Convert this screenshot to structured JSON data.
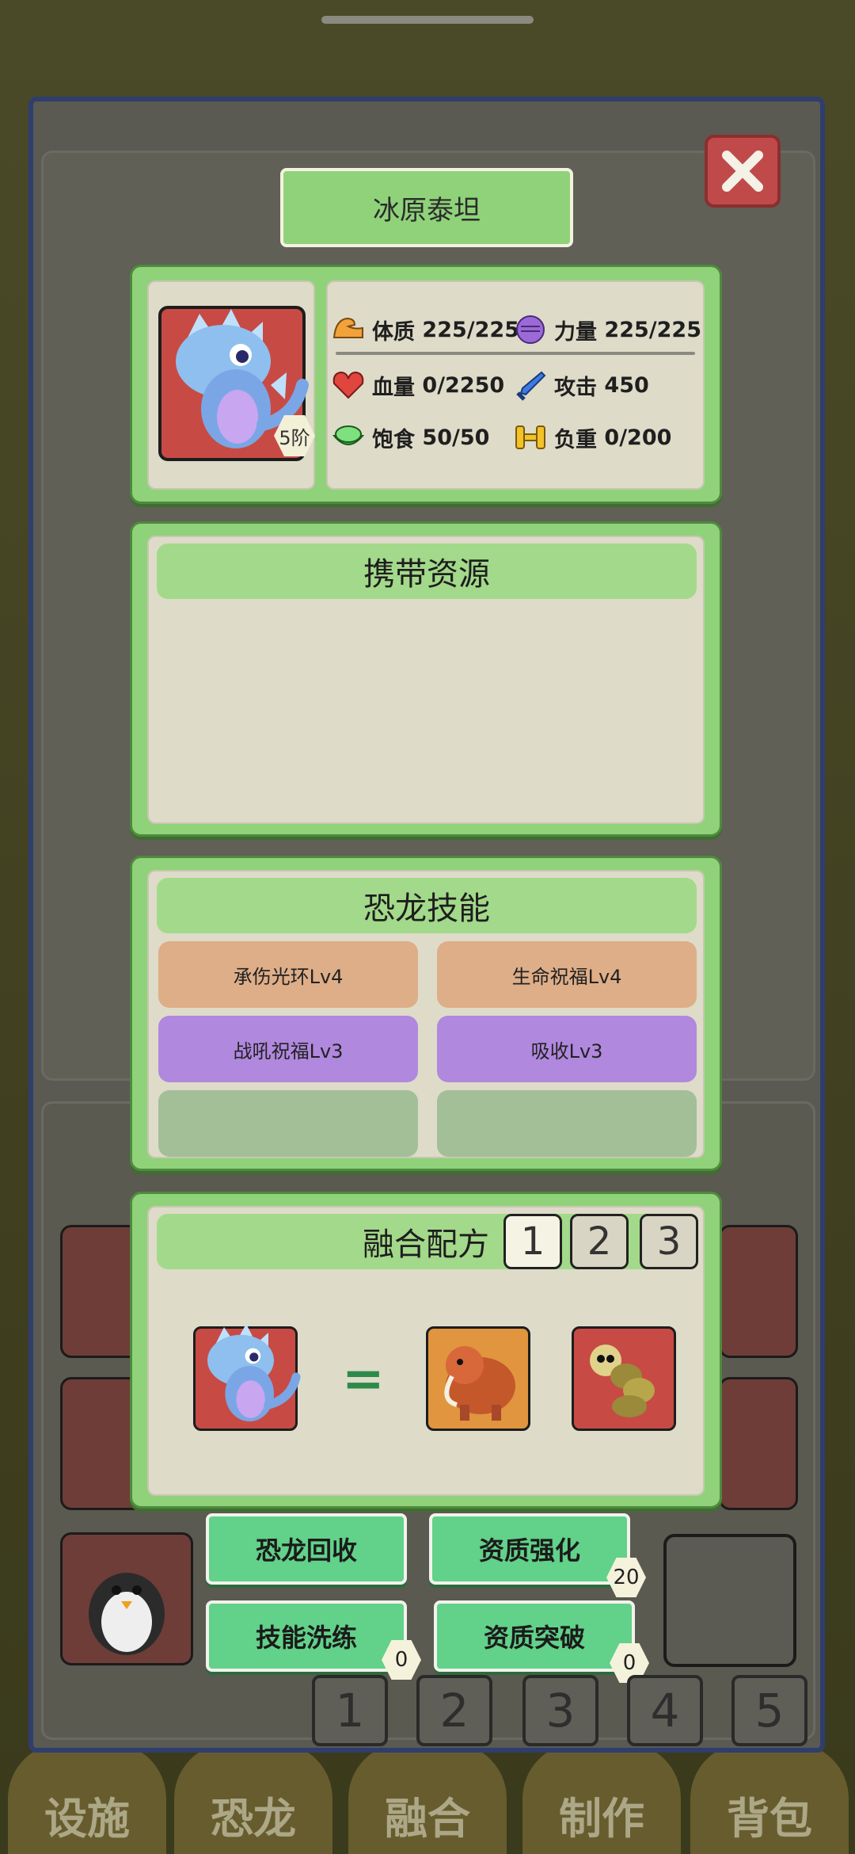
{
  "dino": {
    "name": "冰原泰坦",
    "tier": "5阶",
    "stats": {
      "constitution": {
        "label": "体质",
        "value": "225/225",
        "icon": "muscle-arm-icon",
        "color": "#f2a23a"
      },
      "strength": {
        "label": "力量",
        "value": "225/225",
        "icon": "fist-icon",
        "color": "#9b6ad6"
      },
      "hp": {
        "label": "血量",
        "value": "0/2250",
        "icon": "heart-icon",
        "color": "#e0463e"
      },
      "attack": {
        "label": "攻击",
        "value": "450",
        "icon": "sword-icon",
        "color": "#3d7be0"
      },
      "satiety": {
        "label": "饱食",
        "value": "50/50",
        "icon": "food-bowl-icon",
        "color": "#3fbf3f"
      },
      "load": {
        "label": "负重",
        "value": "0/200",
        "icon": "dumbbell-icon",
        "color": "#f2c22a"
      }
    }
  },
  "resources": {
    "title": "携带资源"
  },
  "skills": {
    "title": "恐龙技能",
    "items": [
      {
        "label": "承伤光环Lv4",
        "color": "#deae88"
      },
      {
        "label": "生命祝福Lv4",
        "color": "#deae88"
      },
      {
        "label": "战吼祝福Lv3",
        "color": "#b088de"
      },
      {
        "label": "吸收Lv3",
        "color": "#b088de"
      },
      {
        "label": "",
        "color": "#a3bf98"
      },
      {
        "label": "",
        "color": "#a3bf98"
      }
    ]
  },
  "recipe": {
    "title": "融合配方",
    "tabs": [
      "1",
      "2",
      "3"
    ],
    "active_tab": "1",
    "equals": "="
  },
  "actions": {
    "recycle": "恐龙回收",
    "enhance": "资质强化",
    "enhance_count": "20",
    "reroll": "技能洗练",
    "reroll_count": "0",
    "breakthrough": "资质突破",
    "breakthrough_count": "0"
  },
  "pages": [
    "1",
    "2",
    "3",
    "4",
    "5"
  ],
  "bottom_nav": [
    "设施",
    "恐龙",
    "融合",
    "制作",
    "背包"
  ]
}
